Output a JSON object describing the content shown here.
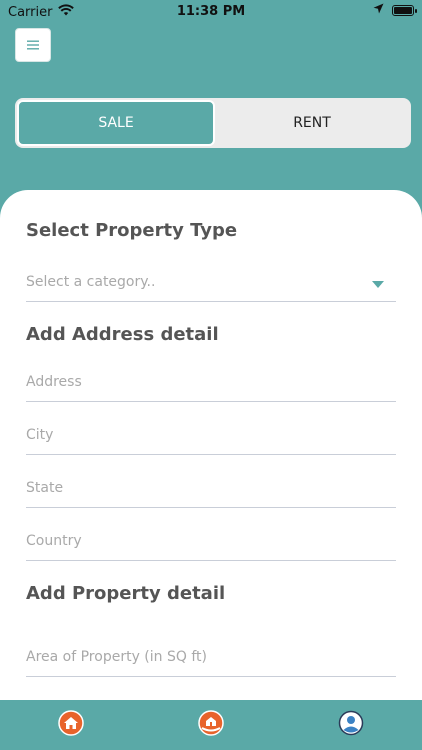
{
  "status_bar": {
    "carrier": "Carrier",
    "time": "11:38 PM"
  },
  "icons": {
    "menu": "menu-icon",
    "wifi": "wifi-icon",
    "location": "location-arrow-icon",
    "battery": "battery-icon",
    "dropdown": "caret-down-icon",
    "tab_home": "home-icon",
    "tab_add": "add-property-icon",
    "tab_profile": "profile-icon"
  },
  "listing_toggle": {
    "sale_label": "SALE",
    "rent_label": "RENT",
    "selected": "SALE"
  },
  "form": {
    "property_type_title": "Select Property Type",
    "category_placeholder": "Select a category..",
    "address_title": "Add Address detail",
    "address_placeholder": "Address",
    "city_placeholder": "City",
    "state_placeholder": "State",
    "country_placeholder": "Country",
    "property_detail_title": "Add Property detail",
    "area_placeholder": "Area of Property (in SQ ft)"
  },
  "colors": {
    "primary": "#5aa9a7",
    "accent_orange": "#e8632b",
    "text_muted": "#a9a9a9"
  }
}
